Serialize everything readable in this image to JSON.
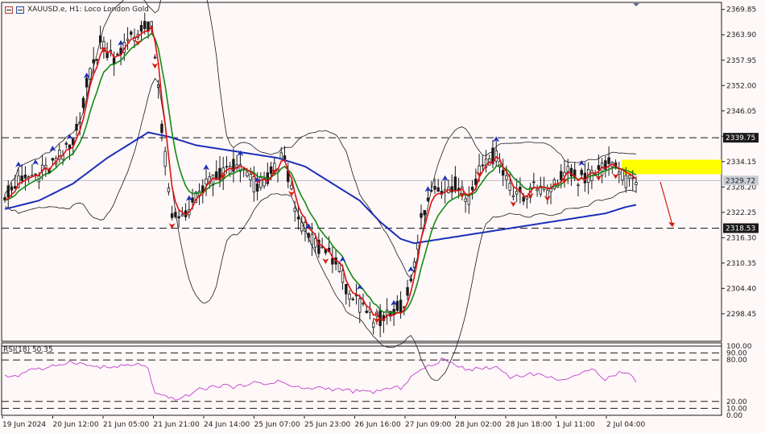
{
  "header": {
    "symbol_label": "XAUUSD.e, H1:  Loco London Gold",
    "icon_menu": "menu-icon",
    "icon_chart": "chart-icon"
  },
  "rsi": {
    "label": "RSI(18) 50.35",
    "levels": [
      100,
      90,
      80,
      20,
      10,
      0
    ],
    "level_labels": [
      "100.00",
      "90.00",
      "80.00",
      "20.00",
      "10.00",
      "0.00"
    ]
  },
  "colors": {
    "background": "#fff8f8",
    "bull_candle": "#1a1a1a",
    "bear_candle": "#1a1a1a",
    "ema_fast": "#e01010",
    "ema_mid": "#138a13",
    "ma_slow": "#1a2fb8",
    "bollinger": "#1a1a1a",
    "rsi_line": "#c040d0",
    "zone": "#ffff00",
    "arrow_up": "#1a2fb8",
    "arrow_down": "#d02010"
  },
  "chart_data": {
    "type": "candlestick",
    "ylim": [
      2292.0,
      2371.5
    ],
    "y_ticks": [
      2369.85,
      2363.9,
      2357.95,
      2352.0,
      2346.05,
      2340.1,
      2334.15,
      2328.2,
      2322.25,
      2316.3,
      2310.35,
      2304.4,
      2298.45
    ],
    "y_tick_labels": [
      "2369.85",
      "2363.90",
      "2357.95",
      "2352.00",
      "2346.05",
      "",
      "2334.15",
      "2328.20",
      "2322.25",
      "2316.30",
      "2310.35",
      "2304.40",
      "2298.45"
    ],
    "x_labels": [
      "19 Jun 2024",
      "20 Jun 12:00",
      "21 Jun 05:00",
      "21 Jun 21:00",
      "24 Jun 14:00",
      "25 Jun 07:00",
      "25 Jun 23:00",
      "26 Jun 16:00",
      "27 Jun 09:00",
      "28 Jun 02:00",
      "28 Jun 18:00",
      "1 Jul 11:00",
      "2 Jul 04:00"
    ],
    "price_path": [
      [
        0,
        2327
      ],
      [
        6,
        2330
      ],
      [
        12,
        2332
      ],
      [
        20,
        2338
      ],
      [
        24,
        2352
      ],
      [
        28,
        2362
      ],
      [
        32,
        2359
      ],
      [
        36,
        2362
      ],
      [
        40,
        2365
      ],
      [
        43,
        2367
      ],
      [
        46,
        2342
      ],
      [
        49,
        2320
      ],
      [
        52,
        2322
      ],
      [
        55,
        2324
      ],
      [
        58,
        2328
      ],
      [
        62,
        2330
      ],
      [
        66,
        2333
      ],
      [
        70,
        2332
      ],
      [
        74,
        2328
      ],
      [
        78,
        2331
      ],
      [
        82,
        2336
      ],
      [
        85,
        2322
      ],
      [
        88,
        2318
      ],
      [
        92,
        2314
      ],
      [
        96,
        2312
      ],
      [
        100,
        2305
      ],
      [
        104,
        2300
      ],
      [
        108,
        2297
      ],
      [
        112,
        2298
      ],
      [
        116,
        2300
      ],
      [
        119,
        2305
      ],
      [
        122,
        2320
      ],
      [
        125,
        2327
      ],
      [
        128,
        2328
      ],
      [
        132,
        2329
      ],
      [
        136,
        2326
      ],
      [
        140,
        2334
      ],
      [
        144,
        2336
      ],
      [
        148,
        2328
      ],
      [
        152,
        2326
      ],
      [
        156,
        2328
      ],
      [
        160,
        2327
      ],
      [
        164,
        2332
      ],
      [
        168,
        2330
      ],
      [
        172,
        2331
      ],
      [
        176,
        2333
      ],
      [
        179,
        2334
      ],
      [
        182,
        2329
      ],
      [
        185,
        2329.72
      ]
    ],
    "current_price": 2329.72,
    "current_price_label": "2329.72",
    "resistance": 2339.75,
    "resistance_label": "2339.75",
    "support": 2318.53,
    "support_label": "2318.53",
    "zone": [
      2331.2,
      2334.6
    ],
    "ma_slow_path": [
      [
        0,
        2323
      ],
      [
        10,
        2325
      ],
      [
        20,
        2329
      ],
      [
        30,
        2335
      ],
      [
        38,
        2339
      ],
      [
        42,
        2341
      ],
      [
        48,
        2340
      ],
      [
        56,
        2338
      ],
      [
        64,
        2337
      ],
      [
        72,
        2336
      ],
      [
        80,
        2335
      ],
      [
        88,
        2333
      ],
      [
        96,
        2329
      ],
      [
        104,
        2325
      ],
      [
        110,
        2320
      ],
      [
        116,
        2316
      ],
      [
        120,
        2315
      ],
      [
        128,
        2316
      ],
      [
        136,
        2317
      ],
      [
        144,
        2318
      ],
      [
        152,
        2319
      ],
      [
        160,
        2320
      ],
      [
        168,
        2321
      ],
      [
        176,
        2322
      ],
      [
        182,
        2323.5
      ],
      [
        185,
        2324
      ]
    ],
    "rsi_path": [
      [
        0,
        56
      ],
      [
        4,
        58
      ],
      [
        8,
        68
      ],
      [
        12,
        66
      ],
      [
        16,
        74
      ],
      [
        20,
        78
      ],
      [
        24,
        72
      ],
      [
        28,
        70
      ],
      [
        32,
        69
      ],
      [
        36,
        72
      ],
      [
        40,
        74
      ],
      [
        42,
        66
      ],
      [
        44,
        30
      ],
      [
        48,
        25
      ],
      [
        52,
        24
      ],
      [
        56,
        36
      ],
      [
        60,
        40
      ],
      [
        64,
        44
      ],
      [
        68,
        40
      ],
      [
        72,
        48
      ],
      [
        76,
        44
      ],
      [
        80,
        50
      ],
      [
        84,
        42
      ],
      [
        88,
        38
      ],
      [
        92,
        40
      ],
      [
        96,
        38
      ],
      [
        100,
        36
      ],
      [
        104,
        34
      ],
      [
        108,
        34
      ],
      [
        112,
        38
      ],
      [
        116,
        40
      ],
      [
        120,
        60
      ],
      [
        124,
        70
      ],
      [
        128,
        80
      ],
      [
        132,
        74
      ],
      [
        136,
        66
      ],
      [
        140,
        68
      ],
      [
        144,
        70
      ],
      [
        148,
        56
      ],
      [
        152,
        58
      ],
      [
        156,
        60
      ],
      [
        160,
        54
      ],
      [
        164,
        52
      ],
      [
        168,
        56
      ],
      [
        172,
        70
      ],
      [
        176,
        52
      ],
      [
        180,
        62
      ],
      [
        184,
        58
      ],
      [
        185,
        50.35
      ]
    ]
  }
}
